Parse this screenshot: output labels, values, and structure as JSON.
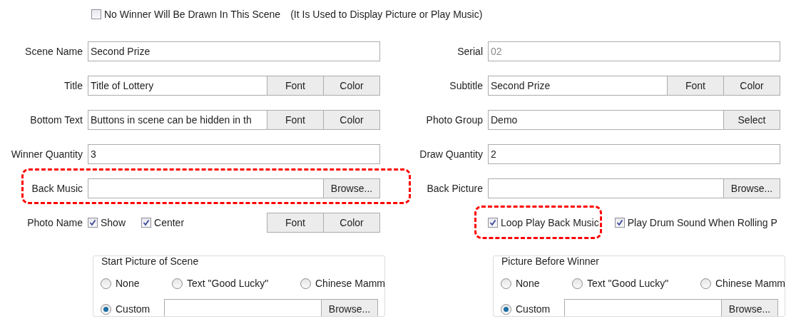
{
  "no_winner": {
    "label": "No Winner Will Be Drawn In This Scene",
    "note": "(It Is Used to Display Picture or Play Music)",
    "checked": false
  },
  "left": {
    "rows": [
      {
        "kind": "field",
        "label": "Scene Name",
        "value": "Second Prize"
      },
      {
        "kind": "field",
        "label": "Title",
        "value": "Title of Lottery",
        "buttons": [
          "Font",
          "Color"
        ]
      },
      {
        "kind": "field",
        "label": "Bottom Text",
        "value": "Buttons in scene can be hidden in th",
        "buttons": [
          "Font",
          "Color"
        ]
      },
      {
        "kind": "field",
        "label": "Winner Quantity",
        "value": "3"
      },
      {
        "kind": "field",
        "label": "Back Music",
        "buttons": [
          "Browse..."
        ],
        "highlighted": true
      },
      {
        "kind": "checks",
        "label": "Photo Name",
        "checks": [
          {
            "label": "Show",
            "checked": true
          },
          {
            "label": "Center",
            "checked": true
          }
        ],
        "buttons": [
          "Font",
          "Color"
        ]
      }
    ],
    "group": {
      "title": "Start Picture of Scene",
      "options": [
        {
          "label": "None",
          "selected": false
        },
        {
          "label": "Text \"Good Lucky\"",
          "selected": false
        },
        {
          "label": "Chinese Mamm",
          "selected": false
        },
        {
          "label": "Custom",
          "selected": true
        }
      ],
      "browse": "Browse..."
    }
  },
  "right": {
    "rows": [
      {
        "kind": "field",
        "label": "Serial",
        "value": "02",
        "disabled": true
      },
      {
        "kind": "field",
        "label": "Subtitle",
        "value": "Second Prize",
        "buttons": [
          "Font",
          "Color"
        ]
      },
      {
        "kind": "field",
        "label": "Photo Group",
        "value": "Demo",
        "buttons": [
          "Select"
        ]
      },
      {
        "kind": "field",
        "label": "Draw Quantity",
        "value": "2"
      },
      {
        "kind": "field",
        "label": "Back Picture",
        "buttons": [
          "Browse..."
        ]
      },
      {
        "kind": "checks",
        "checks": [
          {
            "label": "Loop Play Back Music",
            "checked": true,
            "highlighted": true
          },
          {
            "label": "Play Drum Sound When Rolling P",
            "checked": true
          }
        ]
      }
    ],
    "group": {
      "title": "Picture Before Winner",
      "options": [
        {
          "label": "None",
          "selected": false
        },
        {
          "label": "Text \"Good Lucky\"",
          "selected": false
        },
        {
          "label": "Chinese Mamm",
          "selected": false
        },
        {
          "label": "Custom",
          "selected": true
        }
      ],
      "browse": "Browse..."
    }
  }
}
